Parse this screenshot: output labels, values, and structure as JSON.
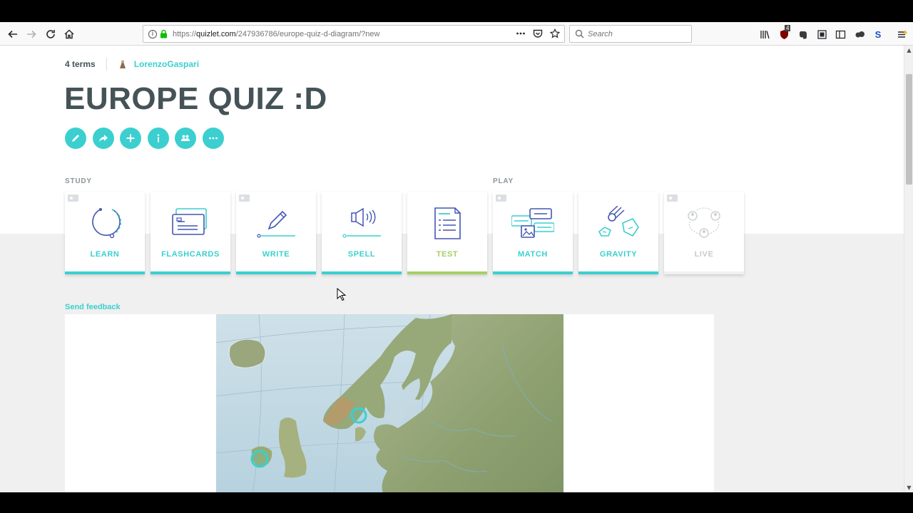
{
  "browser": {
    "url_prefix": "https://",
    "url_domain": "quizlet.com",
    "url_path": "/247936786/europe-quiz-d-diagram/?new",
    "search_placeholder": "Search",
    "extension_badge": "4",
    "extension_s_label": "S"
  },
  "set": {
    "term_count": "4 terms",
    "author": "LorenzoGaspari",
    "title": "EUROPE QUIZ :D"
  },
  "actions": [
    {
      "name": "edit",
      "icon": "pencil-icon"
    },
    {
      "name": "share",
      "icon": "share-arrow-icon"
    },
    {
      "name": "add",
      "icon": "plus-icon"
    },
    {
      "name": "info",
      "icon": "info-icon"
    },
    {
      "name": "class",
      "icon": "people-icon"
    },
    {
      "name": "more",
      "icon": "ellipsis-icon"
    }
  ],
  "sections": {
    "study": "STUDY",
    "play": "PLAY"
  },
  "modes": [
    {
      "label": "LEARN",
      "icon": "learn-icon",
      "accent": "#3ccfcf"
    },
    {
      "label": "FLASHCARDS",
      "icon": "flashcards-icon",
      "accent": "#3ccfcf"
    },
    {
      "label": "WRITE",
      "icon": "write-icon",
      "accent": "#3ccfcf"
    },
    {
      "label": "SPELL",
      "icon": "spell-icon",
      "accent": "#3ccfcf"
    },
    {
      "label": "TEST",
      "icon": "test-icon",
      "accent": "#a6cf66"
    },
    {
      "label": "MATCH",
      "icon": "match-icon",
      "accent": "#3ccfcf"
    },
    {
      "label": "GRAVITY",
      "icon": "gravity-icon",
      "accent": "#3ccfcf"
    },
    {
      "label": "LIVE",
      "icon": "live-icon",
      "accent": "#c7cbcd"
    }
  ],
  "feedback_link": "Send feedback",
  "colors": {
    "brand": "#3ccfcf",
    "title_text": "#455358",
    "test_accent": "#a6cf66"
  }
}
